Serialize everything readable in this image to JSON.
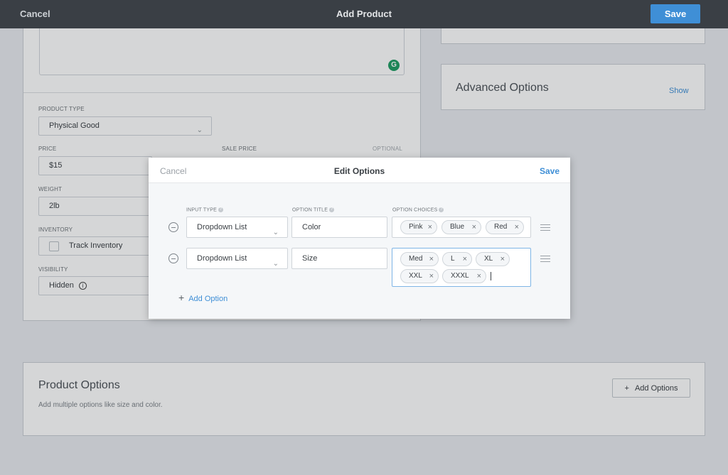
{
  "header": {
    "cancel": "Cancel",
    "title": "Add Product",
    "save": "Save"
  },
  "form": {
    "product_type_label": "PRODUCT TYPE",
    "product_type_value": "Physical Good",
    "price_label": "PRICE",
    "price_value": "$15",
    "sale_price_label": "SALE PRICE",
    "sale_price_hint": "OPTIONAL",
    "weight_label": "WEIGHT",
    "weight_value": "2lb",
    "inventory_label": "INVENTORY",
    "track_inventory": "Track Inventory",
    "visibility_label": "VISIBILITY",
    "visibility_value": "Hidden"
  },
  "advanced": {
    "title": "Advanced Options",
    "show": "Show"
  },
  "product_options": {
    "title": "Product Options",
    "subtitle": "Add multiple options like size and color.",
    "add_button": "Add Options"
  },
  "modal": {
    "cancel": "Cancel",
    "title": "Edit Options",
    "save": "Save",
    "col_input_type": "INPUT TYPE",
    "col_option_title": "OPTION TITLE",
    "col_option_choices": "OPTION CHOICES",
    "rows": [
      {
        "input_type": "Dropdown List",
        "title": "Color",
        "choices": [
          "Pink",
          "Blue",
          "Red"
        ]
      },
      {
        "input_type": "Dropdown List",
        "title": "Size",
        "choices": [
          "Med",
          "L",
          "XL",
          "XXL",
          "XXXL"
        ]
      }
    ],
    "add_option": "Add Option"
  },
  "icons": {
    "grammarly": "grammarly-icon",
    "chevron": "chevron-down-icon",
    "info": "info-icon",
    "remove": "minus-circle-icon",
    "drag": "drag-handle-icon",
    "plus": "plus-icon",
    "chip_remove": "close-icon"
  },
  "colors": {
    "accent": "#3f8fd6",
    "topbar": "#3a3f45"
  }
}
